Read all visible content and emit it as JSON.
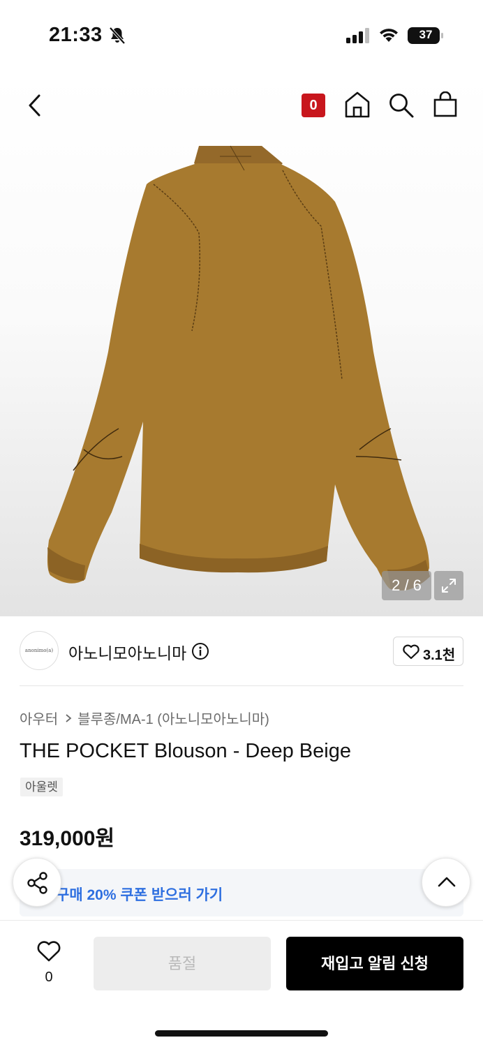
{
  "status_bar": {
    "time": "21:33",
    "battery": "37"
  },
  "header": {
    "cart_count": "0"
  },
  "gallery": {
    "counter": "2 / 6"
  },
  "brand": {
    "logo_text": "anonimo(a)",
    "name": "아노니모아노니마",
    "likes": "3.1천"
  },
  "product": {
    "breadcrumb": [
      "아우터",
      "블루종/MA-1 (아노니모아노니마)"
    ],
    "title": "THE POCKET Blouson - Deep Beige",
    "tag": "아울렛",
    "price": "319,000원"
  },
  "coupon": {
    "text": "구매 20% 쿠폰 받으러 가기"
  },
  "bottom": {
    "wish_count": "0",
    "soldout_label": "품절",
    "restock_label": "재입고 알림 신청"
  },
  "colors": {
    "accent_red": "#c8161d",
    "coupon_blue": "#2e6fe0",
    "jacket": "#a77a2f"
  }
}
